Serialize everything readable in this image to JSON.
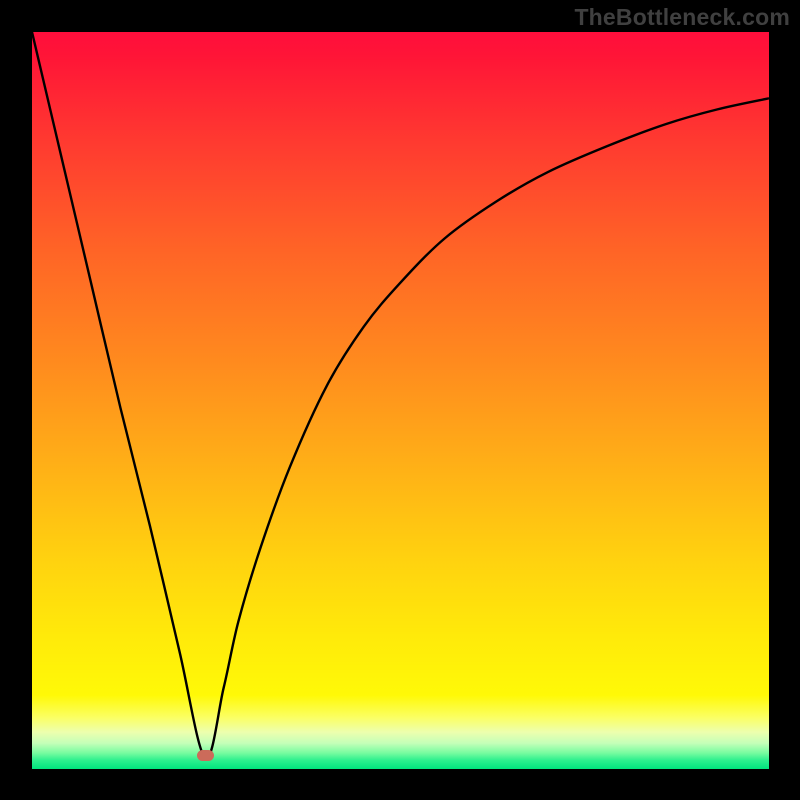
{
  "attribution": "TheBottleneck.com",
  "colors": {
    "frame_bg": "#000000",
    "curve_stroke": "#000000",
    "marker_fill": "#cc6b5a",
    "gradient_stops": [
      "#ff0e3c",
      "#ff6526",
      "#ffd30f",
      "#fff907",
      "#00e47d"
    ]
  },
  "chart_data": {
    "type": "line",
    "title": "",
    "xlabel": "",
    "ylabel": "",
    "xlim": [
      0,
      100
    ],
    "ylim": [
      0,
      100
    ],
    "grid": false,
    "legend": false,
    "annotations": [
      {
        "kind": "marker",
        "shape": "rounded-rect",
        "x": 23.5,
        "y": 1.8,
        "color": "#cc6b5a"
      }
    ],
    "series": [
      {
        "name": "curve",
        "x": [
          0,
          4,
          8,
          12,
          16,
          20,
          23.5,
          26,
          28,
          31,
          35,
          40,
          45,
          50,
          56,
          63,
          70,
          78,
          86,
          93,
          100
        ],
        "values": [
          100,
          83,
          66,
          49,
          33,
          16,
          1.5,
          11,
          20,
          30,
          41,
          52,
          60,
          66,
          72,
          77,
          81,
          84.5,
          87.5,
          89.5,
          91
        ]
      }
    ]
  }
}
